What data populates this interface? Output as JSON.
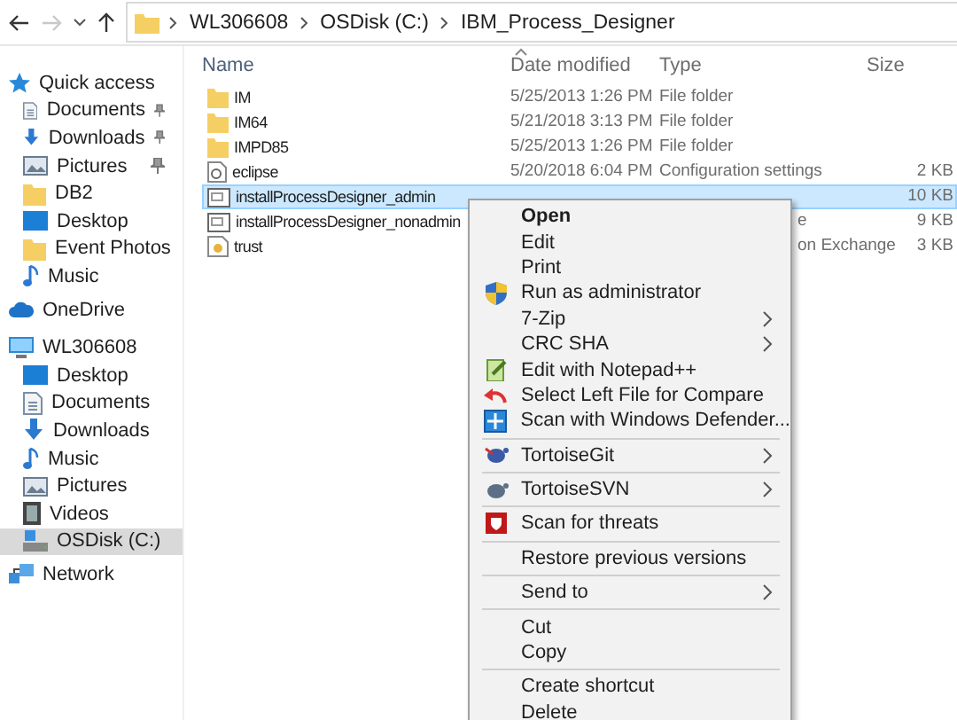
{
  "address_bar": {
    "breadcrumbs": [
      "WL306608",
      "OSDisk (C:)",
      "IBM_Process_Designer"
    ],
    "forward_disabled": true
  },
  "columns": [
    "Name",
    "Date modified",
    "Type",
    "Size"
  ],
  "sidebar": [
    {
      "label": "Quick access",
      "selected": false,
      "children": [
        {
          "label": "Documents",
          "pinned": true,
          "selected": false
        },
        {
          "label": "Downloads",
          "pinned": true,
          "selected": false
        },
        {
          "label": "Pictures",
          "pinned": true,
          "selected": false
        },
        {
          "label": "DB2",
          "pinned": false,
          "selected": false
        },
        {
          "label": "Desktop",
          "pinned": false,
          "selected": false
        },
        {
          "label": "Event Photos",
          "pinned": false,
          "selected": false
        },
        {
          "label": "Music",
          "pinned": false,
          "selected": false
        }
      ]
    },
    {
      "label": "OneDrive",
      "selected": false
    },
    {
      "label": "WL306608",
      "selected": false,
      "children": [
        {
          "label": "Desktop",
          "pinned": false,
          "selected": false
        },
        {
          "label": "Documents",
          "pinned": false,
          "selected": false
        },
        {
          "label": "Downloads",
          "pinned": false,
          "selected": false
        },
        {
          "label": "Music",
          "pinned": false,
          "selected": false
        },
        {
          "label": "Pictures",
          "pinned": false,
          "selected": false
        },
        {
          "label": "Videos",
          "pinned": false,
          "selected": false
        },
        {
          "label": "OSDisk (C:)",
          "pinned": false,
          "selected": true
        }
      ]
    },
    {
      "label": "Network",
      "selected": false
    }
  ],
  "files": [
    {
      "name": "IM",
      "date": "5/25/2013 1:26 PM",
      "type": "File folder",
      "selected": false
    },
    {
      "name": "IM64",
      "date": "5/21/2018 3:13 PM",
      "type": "File folder",
      "selected": false
    },
    {
      "name": "IMPD85",
      "date": "5/25/2013 1:26 PM",
      "type": "File folder",
      "selected": false
    },
    {
      "name": "eclipse",
      "date": "5/20/2018 6:04 PM",
      "type": "Configuration settings",
      "size": "2 KB",
      "selected": false
    },
    {
      "name": "installProcessDesigner_admin",
      "size": "10 KB",
      "selected": true
    },
    {
      "name": "installProcessDesigner_nonadmin",
      "type": "e",
      "size": "9 KB",
      "selected": false,
      "under_menu": true
    },
    {
      "name": "trust",
      "type": "on Exchange",
      "size": "3 KB",
      "selected": false,
      "under_menu": true
    }
  ],
  "context_menu": [
    {
      "kind": "item",
      "label": "Open",
      "default": true,
      "submenu": false
    },
    {
      "kind": "item",
      "label": "Edit",
      "default": false,
      "submenu": false
    },
    {
      "kind": "item",
      "label": "Print",
      "default": false,
      "submenu": false
    },
    {
      "kind": "item",
      "label": "Run as administrator",
      "default": false,
      "submenu": false
    },
    {
      "kind": "item",
      "label": "7-Zip",
      "default": false,
      "submenu": true
    },
    {
      "kind": "item",
      "label": "CRC SHA",
      "default": false,
      "submenu": true
    },
    {
      "kind": "item",
      "label": "Edit with Notepad++",
      "default": false,
      "submenu": false
    },
    {
      "kind": "item",
      "label": "Select Left File for Compare",
      "default": false,
      "submenu": false
    },
    {
      "kind": "item",
      "label": "Scan with Windows Defender...",
      "default": false,
      "submenu": false
    },
    {
      "kind": "separator"
    },
    {
      "kind": "item",
      "label": "TortoiseGit",
      "default": false,
      "submenu": true
    },
    {
      "kind": "separator"
    },
    {
      "kind": "item",
      "label": "TortoiseSVN",
      "default": false,
      "submenu": true
    },
    {
      "kind": "separator"
    },
    {
      "kind": "item",
      "label": "Scan for threats",
      "default": false,
      "submenu": false
    },
    {
      "kind": "separator"
    },
    {
      "kind": "item",
      "label": "Restore previous versions",
      "default": false,
      "submenu": false
    },
    {
      "kind": "separator"
    },
    {
      "kind": "item",
      "label": "Send to",
      "default": false,
      "submenu": true
    },
    {
      "kind": "separator"
    },
    {
      "kind": "item",
      "label": "Cut",
      "default": false,
      "submenu": false
    },
    {
      "kind": "item",
      "label": "Copy",
      "default": false,
      "submenu": false
    },
    {
      "kind": "separator"
    },
    {
      "kind": "item",
      "label": "Create shortcut",
      "default": false,
      "submenu": false
    },
    {
      "kind": "item",
      "label": "Delete",
      "default": false,
      "submenu": false
    }
  ]
}
